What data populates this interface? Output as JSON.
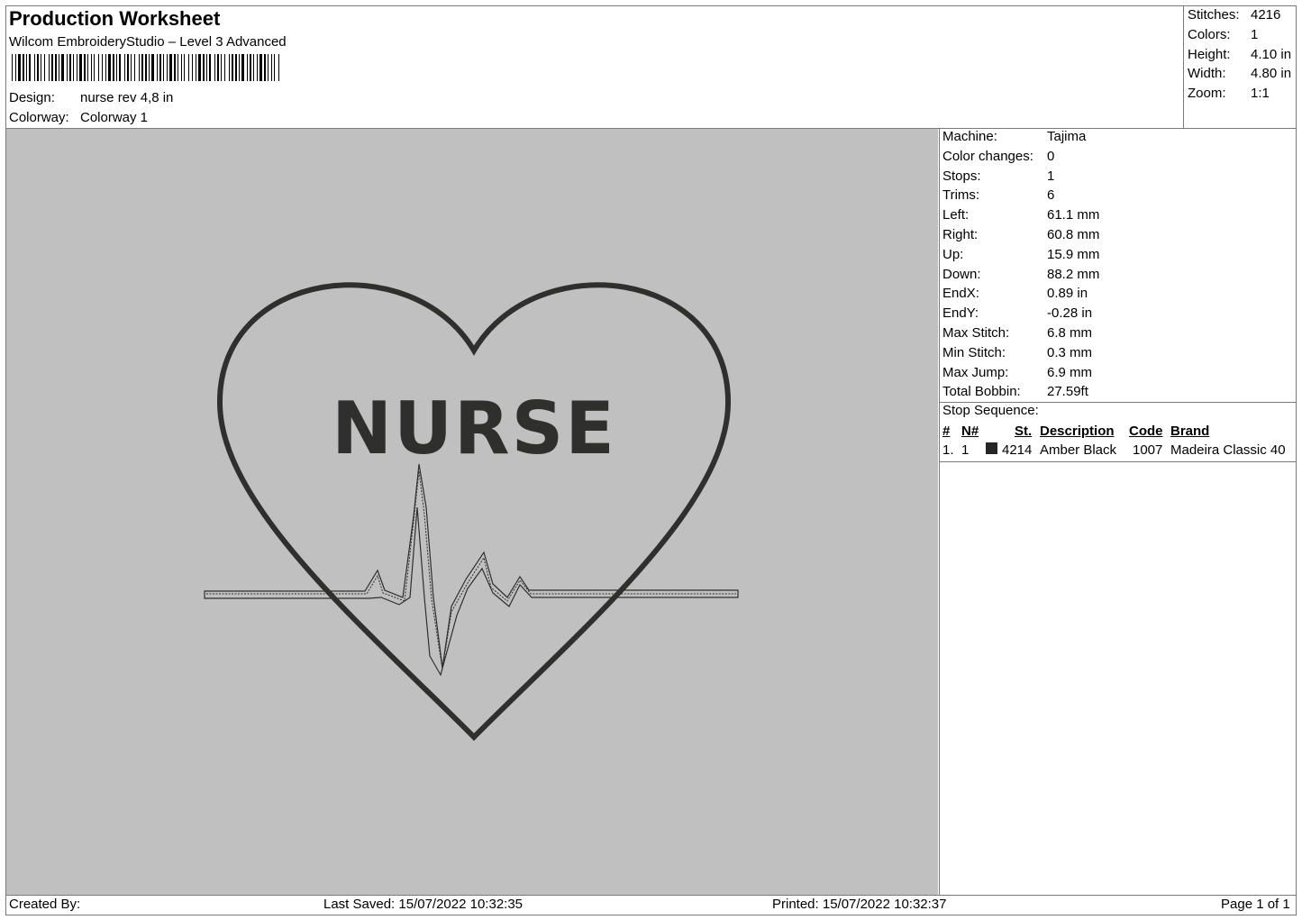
{
  "header": {
    "title": "Production Worksheet",
    "subtitle": "Wilcom EmbroideryStudio – Level 3 Advanced",
    "design_label": "Design:",
    "design_value": "nurse rev 4,8 in",
    "colorway_label": "Colorway:",
    "colorway_value": "Colorway 1"
  },
  "summary": {
    "stitches_label": "Stitches:",
    "stitches_value": "4216",
    "colors_label": "Colors:",
    "colors_value": "1",
    "height_label": "Height:",
    "height_value": "4.10 in",
    "width_label": "Width:",
    "width_value": "4.80 in",
    "zoom_label": "Zoom:",
    "zoom_value": "1:1"
  },
  "design_preview": {
    "text": "NURSE",
    "thread_color": "#2f302d",
    "background_color": "#c0c0c0"
  },
  "machine_info": [
    {
      "label": "Machine:",
      "value": "Tajima"
    },
    {
      "label": "Color changes:",
      "value": "0"
    },
    {
      "label": "Stops:",
      "value": "1"
    },
    {
      "label": "Trims:",
      "value": "6"
    },
    {
      "label": "Left:",
      "value": "61.1 mm"
    },
    {
      "label": "Right:",
      "value": "60.8 mm"
    },
    {
      "label": "Up:",
      "value": "15.9 mm"
    },
    {
      "label": "Down:",
      "value": "88.2 mm"
    },
    {
      "label": "EndX:",
      "value": "0.89 in"
    },
    {
      "label": "EndY:",
      "value": "-0.28 in"
    },
    {
      "label": "Max Stitch:",
      "value": "6.8 mm"
    },
    {
      "label": "Min Stitch:",
      "value": "0.3 mm"
    },
    {
      "label": "Max Jump:",
      "value": "6.9 mm"
    },
    {
      "label": "Total Bobbin:",
      "value": "27.59ft"
    }
  ],
  "stop_sequence": {
    "label": "Stop Sequence:",
    "headers": {
      "num": "#",
      "n": "N#",
      "st": "St.",
      "description": "Description",
      "code": "Code",
      "brand": "Brand"
    },
    "rows": [
      {
        "num": "1.",
        "n": "1",
        "swatch_color": "#262626",
        "st": "4214",
        "description": "Amber Black",
        "code": "1007",
        "brand": "Madeira Classic 40"
      }
    ]
  },
  "footer": {
    "created_by": "Created By:",
    "last_saved": "Last Saved: 15/07/2022 10:32:35",
    "printed": "Printed: 15/07/2022 10:32:37",
    "page": "Page 1 of 1"
  }
}
